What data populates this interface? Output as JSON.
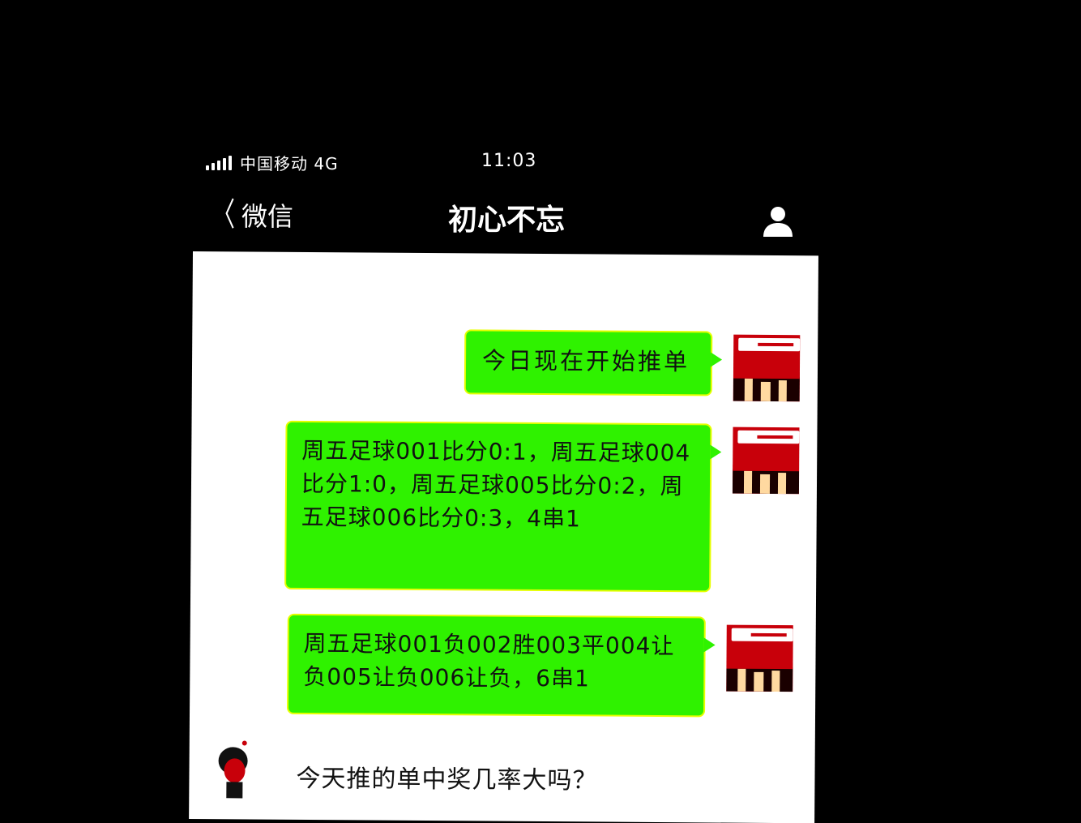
{
  "status_bar": {
    "carrier": "中国移动  4G",
    "time": "11:03"
  },
  "nav": {
    "back_label": "微信",
    "title": "初心不忘"
  },
  "messages": [
    {
      "direction": "outgoing",
      "text": "今日现在开始推单"
    },
    {
      "direction": "outgoing",
      "text": "周五足球001比分0:1，周五足球004比分1:0，周五足球005比分0:2，周五足球006比分0:3，4串1"
    },
    {
      "direction": "outgoing",
      "text": "周五足球001负002胜003平004让负005让负006让负，6串1"
    },
    {
      "direction": "incoming",
      "text": "今天推的单中奖几率大吗？"
    }
  ],
  "icons": {
    "signal": "signal-bars-icon",
    "back": "chevron-left-icon",
    "profile": "person-icon"
  },
  "colors": {
    "background": "#000000",
    "chat_background": "#ffffff",
    "bubble_green": "#2ff200",
    "avatar_red": "#c8000a"
  }
}
